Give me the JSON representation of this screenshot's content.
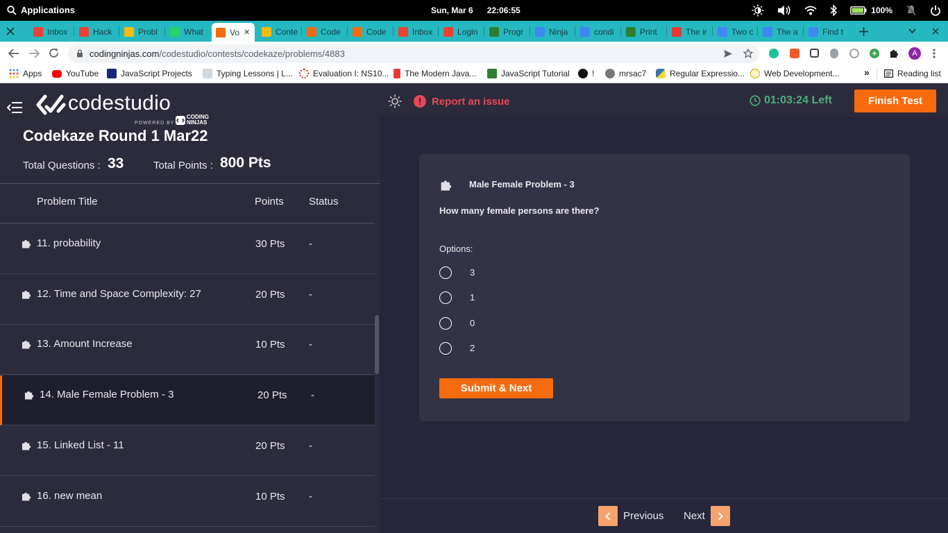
{
  "os": {
    "apps_label": "Applications",
    "date": "Sun, Mar  6",
    "time": "22:06:55",
    "battery": "100%"
  },
  "browser": {
    "tabs": [
      "Inbox",
      "Hack",
      "Probl",
      "What",
      "Vo",
      "Conte",
      "Code",
      "Code",
      "Inbox",
      "Login",
      "Progr",
      "Ninja",
      "condi",
      "Print",
      "The ir",
      "Two c",
      "The a",
      "Find t"
    ],
    "url_host": "codingninjas.com",
    "url_path": "/codestudio/contests/codekaze/problems/4883",
    "profile_initial": "A",
    "bookmarks": [
      "Apps",
      "YouTube",
      "JavaScript Projects",
      "Typing Lessons | L...",
      "Evaluation I: NS10...",
      "The Modern Java...",
      "JavaScript Tutorial",
      "!",
      "mrsac7",
      "Regular Expressio...",
      "Web Development...",
      "Reading list"
    ],
    "more_bookmarks": "»"
  },
  "brand": {
    "name": "codestudio",
    "powered_by": "POWERED BY",
    "cn_line1": "CODING",
    "cn_line2": "NINJAS"
  },
  "contest": {
    "title": "Codekaze Round 1 Mar22",
    "total_questions_label": "Total Questions :",
    "total_questions": "33",
    "total_points_label": "Total Points :",
    "total_points": "800 Pts"
  },
  "table": {
    "headers": [
      "Problem Title",
      "Points",
      "Status"
    ],
    "rows": [
      {
        "title": "11. probability",
        "points": "30 Pts",
        "status": "-"
      },
      {
        "title": "12. Time and Space Complexity: 27",
        "points": "20 Pts",
        "status": "-"
      },
      {
        "title": "13. Amount Increase",
        "points": "10 Pts",
        "status": "-"
      },
      {
        "title": "14. Male Female Problem - 3",
        "points": "20 Pts",
        "status": "-"
      },
      {
        "title": "15. Linked List - 11",
        "points": "20 Pts",
        "status": "-"
      },
      {
        "title": "16. new mean",
        "points": "10 Pts",
        "status": "-"
      }
    ],
    "active_index": 3
  },
  "header": {
    "report_label": "Report an issue",
    "timer": "01:03:24 Left",
    "finish_label": "Finish Test"
  },
  "question": {
    "title": "Male Female Problem - 3",
    "text": "How many female persons are there?",
    "options_label": "Options:",
    "options": [
      "3",
      "1",
      "0",
      "2"
    ],
    "submit_label": "Submit & Next"
  },
  "pager": {
    "previous_label": "Previous",
    "next_label": "Next"
  },
  "colors": {
    "accent": "#f66b0e",
    "timer_green": "#4caf7d",
    "report_red": "#e54858",
    "tabstrip": "#26b8c0"
  }
}
